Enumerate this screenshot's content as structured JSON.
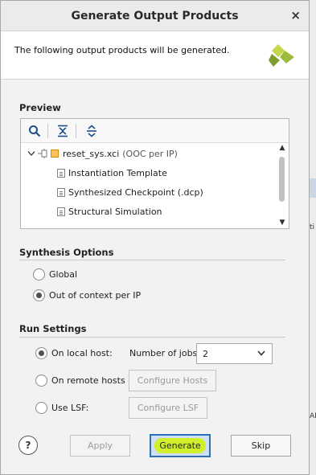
{
  "dialog": {
    "title": "Generate Output Products",
    "close_glyph": "×",
    "header_text": "The following output products will be generated."
  },
  "preview": {
    "title": "Preview",
    "toolbar": [
      "search-icon",
      "collapse-all-icon",
      "expand-all-icon"
    ],
    "tree": {
      "root_name": "reset_sys.xci",
      "root_suffix": "(OOC per IP)",
      "children": [
        "Instantiation Template",
        "Synthesized Checkpoint (.dcp)",
        "Structural Simulation"
      ]
    }
  },
  "synthesis": {
    "title": "Synthesis Options",
    "options": [
      {
        "label": "Global",
        "selected": false
      },
      {
        "label": "Out of context per IP",
        "selected": true
      }
    ]
  },
  "run": {
    "title": "Run Settings",
    "local_label": "On local host:",
    "jobs_label": "Number of jobs:",
    "jobs_value": "2",
    "remote_label": "On remote hosts",
    "configure_hosts": "Configure Hosts",
    "lsf_label": "Use LSF:",
    "configure_lsf": "Configure LSF",
    "selected": "local"
  },
  "footer": {
    "help": "?",
    "apply": "Apply",
    "generate": "Generate",
    "skip": "Skip"
  },
  "background": {
    "right_edge_fragments": [
      "ti",
      "AN"
    ]
  },
  "colors": {
    "primary_border": "#2f6fb5",
    "generate_highlight": "#d2ef2b",
    "logo_green": "#9dbb3a"
  }
}
